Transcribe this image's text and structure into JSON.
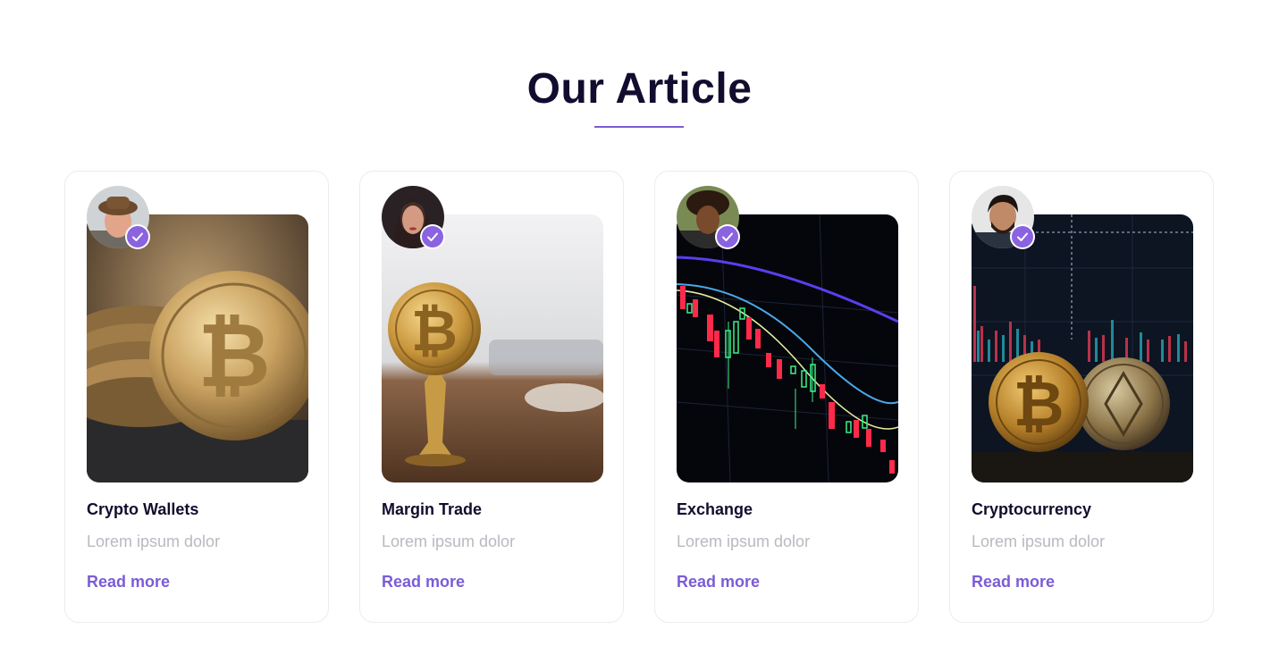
{
  "section": {
    "title": "Our Article"
  },
  "colors": {
    "accent": "#7b5cd6",
    "title": "#120d2e",
    "muted": "#b9b9c1"
  },
  "articles": [
    {
      "title": "Crypto Wallets",
      "description": "Lorem ipsum dolor",
      "link_label": "Read more",
      "image_icon": "bitcoin-coins-image",
      "avatar_icon": "author-avatar"
    },
    {
      "title": "Margin Trade",
      "description": "Lorem ipsum dolor",
      "link_label": "Read more",
      "image_icon": "bitcoin-stamp-image",
      "avatar_icon": "author-avatar"
    },
    {
      "title": "Exchange",
      "description": "Lorem ipsum dolor",
      "link_label": "Read more",
      "image_icon": "candlestick-chart-image",
      "avatar_icon": "author-avatar"
    },
    {
      "title": "Cryptocurrency",
      "description": "Lorem ipsum dolor",
      "link_label": "Read more",
      "image_icon": "crypto-coins-chart-image",
      "avatar_icon": "author-avatar"
    }
  ]
}
